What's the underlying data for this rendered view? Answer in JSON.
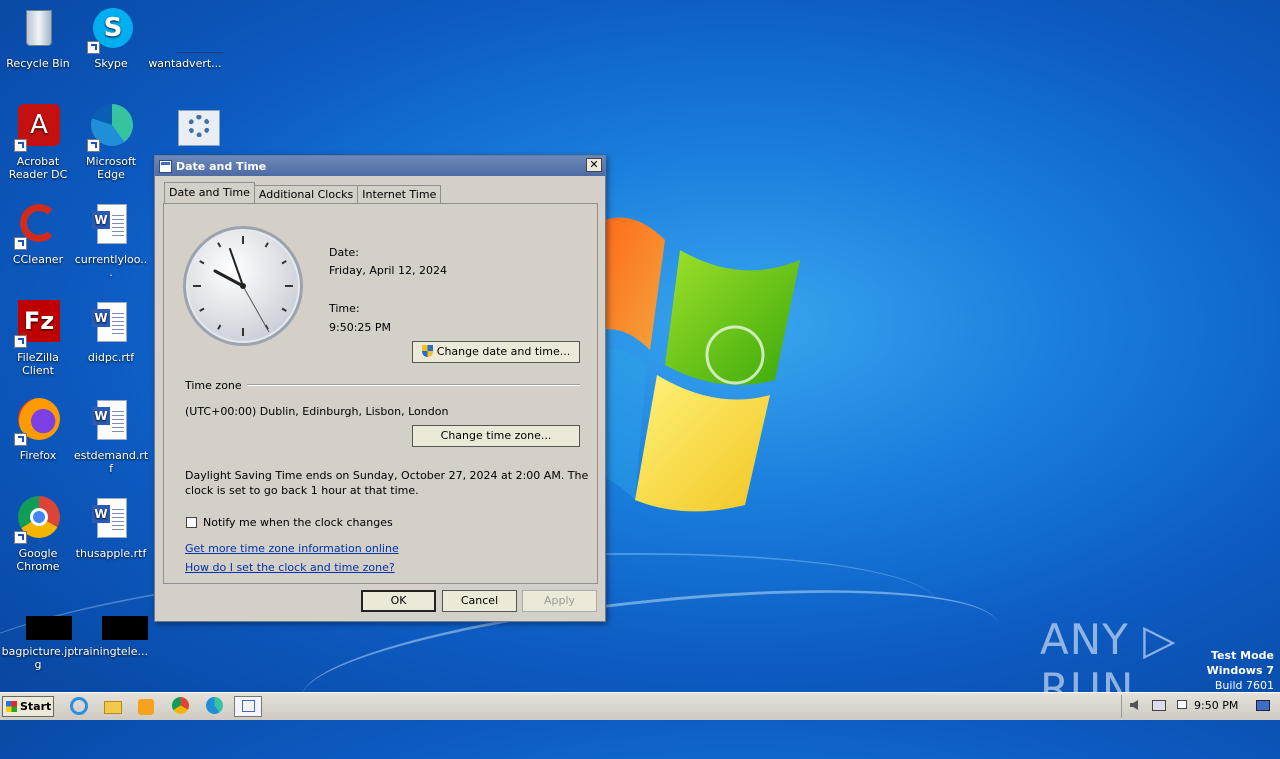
{
  "desktop": {
    "icons": [
      {
        "label": "Recycle Bin"
      },
      {
        "label": "Skype"
      },
      {
        "label": "wantadvert..."
      },
      {
        "label": "Acrobat Reader DC"
      },
      {
        "label": "Microsoft Edge"
      },
      {
        "label": "CCleaner"
      },
      {
        "label": "currentlyloo..."
      },
      {
        "label": "FileZilla Client"
      },
      {
        "label": "didpc.rtf"
      },
      {
        "label": "Firefox"
      },
      {
        "label": "estdemand.rtf"
      },
      {
        "label": "Google Chrome"
      },
      {
        "label": "thusapple.rtf"
      },
      {
        "label": "bagpicture.jpg"
      },
      {
        "label": "trainingtele..."
      }
    ]
  },
  "dialog": {
    "title": "Date and Time",
    "close_label": "✕",
    "tabs": [
      {
        "label": "Date and Time",
        "active": true
      },
      {
        "label": "Additional Clocks",
        "active": false
      },
      {
        "label": "Internet Time",
        "active": false
      }
    ],
    "date_label": "Date:",
    "date_value": "Friday, April 12, 2024",
    "time_label": "Time:",
    "time_value": "9:50:25 PM",
    "change_datetime_button": "Change date and time...",
    "timezone_heading": "Time zone",
    "timezone_value": "(UTC+00:00) Dublin, Edinburgh, Lisbon, London",
    "change_timezone_button": "Change time zone...",
    "dst_text_line1": "Daylight Saving Time ends on Sunday, October 27, 2024 at 2:00 AM. The",
    "dst_text_line2": "clock is set to go back 1 hour at that time.",
    "notify_label": "Notify me when the clock changes",
    "notify_checked": false,
    "link_more_info": "Get more time zone information online",
    "link_how_set": "How do I set the clock and time zone?",
    "ok_label": "OK",
    "cancel_label": "Cancel",
    "apply_label": "Apply"
  },
  "watermark": {
    "brand": "ANY ▷ RUN",
    "test_mode": "Test Mode",
    "os": "Windows 7",
    "build": "Build 7601"
  },
  "taskbar": {
    "start_label": "Start",
    "clock": "9:50 PM"
  },
  "colors": {
    "desktop_blue": "#1a7fdd",
    "title_blue": "#4d6aa3",
    "dialog_gray": "#d4d0c8",
    "link_blue": "#0033aa"
  }
}
